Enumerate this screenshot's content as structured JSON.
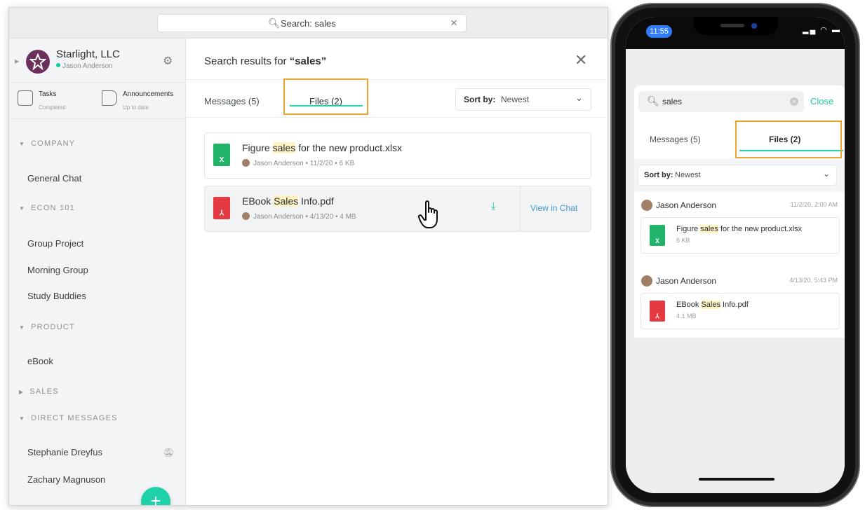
{
  "desktop": {
    "top_search": {
      "text": "Search: sales"
    },
    "org": {
      "name": "Starlight, LLC",
      "user": "Jason Anderson"
    },
    "quick_links": [
      {
        "label": "Tasks",
        "sub": "Completed"
      },
      {
        "label": "Announcements",
        "sub": "Up to date"
      }
    ],
    "sections": {
      "company": "COMPANY",
      "econ": "ECON 101",
      "product": "PRODUCT",
      "sales": "SALES",
      "dm": "DIRECT MESSAGES"
    },
    "channels": {
      "general": "General Chat",
      "group_project": "Group Project",
      "morning_group": "Morning Group",
      "study_buddies": "Study Buddies",
      "ebook": "eBook",
      "stephanie": "Stephanie Dreyfus",
      "zachary": "Zachary Magnuson"
    },
    "main": {
      "title_prefix": "Search results for ",
      "query": "“sales”",
      "tabs": {
        "messages": "Messages (5)",
        "files": "Files (2)"
      },
      "sort": {
        "label": "Sort by:",
        "value": "Newest"
      },
      "files": [
        {
          "name_pre": "Figure ",
          "name_hl": "sales",
          "name_post": " for the new product.xlsx",
          "author": "Jason Anderson",
          "date": "11/2/20",
          "size": "6 KB",
          "type": "xls"
        },
        {
          "name_pre": "EBook ",
          "name_hl": "Sales",
          "name_post": " Info.pdf",
          "author": "Jason Anderson",
          "date": "4/13/20",
          "size": "4 MB",
          "type": "pdf"
        }
      ],
      "view_in_chat": "View in Chat",
      "meta_sep": "•"
    }
  },
  "phone": {
    "time": "11:55",
    "search": {
      "text": "sales",
      "close": "Close"
    },
    "tabs": {
      "messages": "Messages (5)",
      "files": "Files (2)"
    },
    "sort": {
      "label": "Sort by:",
      "value": "Newest"
    },
    "groups": [
      {
        "author": "Jason Anderson",
        "date": "11/2/20, 2:00 AM",
        "name_pre": "Figure ",
        "name_hl": "sales",
        "name_post": " for the new product.xlsx",
        "size": "6 KB",
        "type": "xls"
      },
      {
        "author": "Jason Anderson",
        "date": "4/13/20, 5:43 PM",
        "name_pre": "EBook ",
        "name_hl": "Sales",
        "name_post": " Info.pdf",
        "size": "4.1 MB",
        "type": "pdf"
      }
    ]
  },
  "colors": {
    "accent": "#1fd1a9",
    "highlight_box": "#e8a530",
    "link": "#3e97d1",
    "xls": "#22b36b",
    "pdf": "#e53a44"
  },
  "icons": [
    "search-icon",
    "close-icon",
    "gear-icon",
    "clipboard-icon",
    "megaphone-icon",
    "chevron-down-icon",
    "spreadsheet-icon",
    "pdf-icon",
    "download-icon",
    "hand-cursor-icon",
    "mute-icon",
    "plus-icon"
  ]
}
